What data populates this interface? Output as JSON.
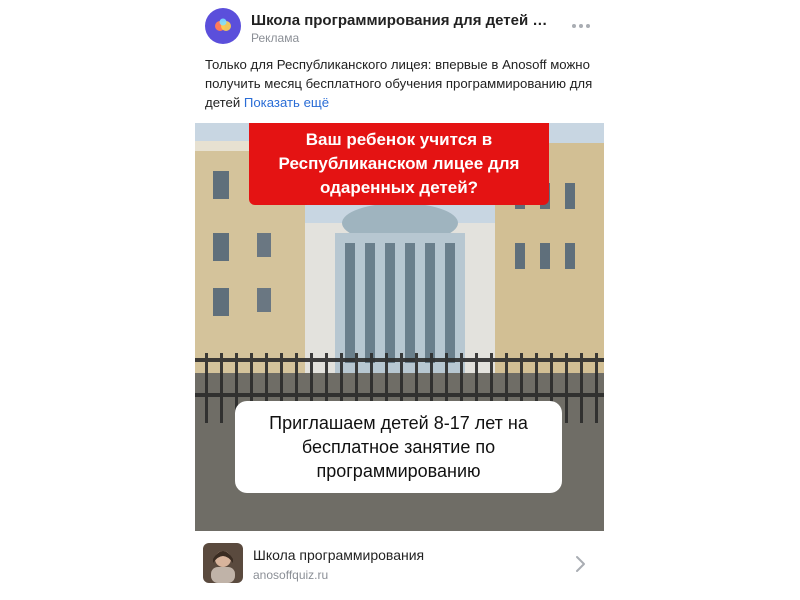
{
  "post": {
    "author": "Школа программирования для детей | A...",
    "label": "Реклама",
    "text_main": "Только для Республиканского лицея: впервые в Anosoff можно получить месяц бесплатного обучения программированию для детей",
    "show_more": "Показать ещё"
  },
  "image": {
    "top_banner": "Ваш ребенок учится в Республиканском лицее для одаренных детей?",
    "bottom_banner": "Приглашаем детей 8-17 лет на бесплатное занятие по программированию"
  },
  "link": {
    "title": "Школа программирования",
    "url": "anosoffquiz.ru"
  },
  "colors": {
    "accent_link": "#2a6dd6",
    "banner_red": "#e41313",
    "avatar_bg": "#5b4fdb"
  },
  "icons": {
    "more": "more-dots-icon",
    "chevron": "chevron-right-icon",
    "brand": "anosoff-logo-icon"
  }
}
